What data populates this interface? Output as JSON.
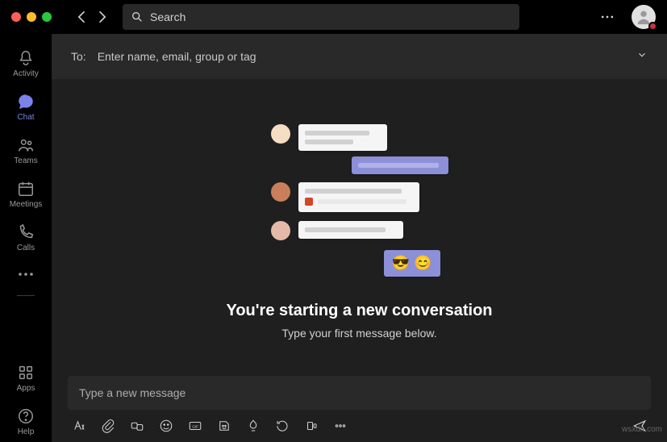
{
  "search": {
    "placeholder": "Search"
  },
  "rail": {
    "activity": "Activity",
    "chat": "Chat",
    "teams": "Teams",
    "meetings": "Meetings",
    "calls": "Calls",
    "apps": "Apps",
    "help": "Help"
  },
  "to": {
    "label": "To:",
    "placeholder": "Enter name, email, group or tag"
  },
  "empty": {
    "headline": "You're starting a new conversation",
    "subline": "Type your first message below."
  },
  "composer": {
    "placeholder": "Type a new message"
  },
  "watermark": "wsxdn.com"
}
